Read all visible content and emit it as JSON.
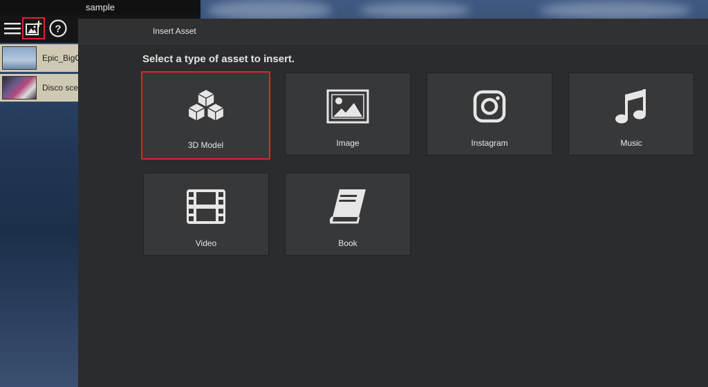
{
  "window": {
    "title": "sample"
  },
  "toolbar": {
    "menu_icon": "hamburger-icon",
    "insert_icon": "insert-image-icon",
    "help_icon": "help-icon"
  },
  "assets": [
    {
      "name": "Epic_BigC",
      "thumb": "sky"
    },
    {
      "name": "Disco sce",
      "thumb": "disco"
    }
  ],
  "dialog": {
    "title": "Insert Asset",
    "prompt": "Select a type of asset to insert.",
    "options": [
      {
        "label": "3D Model",
        "icon": "cubes-icon",
        "selected": true
      },
      {
        "label": "Image",
        "icon": "image-icon",
        "selected": false
      },
      {
        "label": "Instagram",
        "icon": "instagram-icon",
        "selected": false
      },
      {
        "label": "Music",
        "icon": "music-icon",
        "selected": false
      },
      {
        "label": "Video",
        "icon": "film-icon",
        "selected": false
      },
      {
        "label": "Book",
        "icon": "book-icon",
        "selected": false
      }
    ]
  },
  "colors": {
    "highlight": "#e2232b",
    "dialog_bg": "#2b2c2e",
    "tile_bg": "#37383a"
  }
}
